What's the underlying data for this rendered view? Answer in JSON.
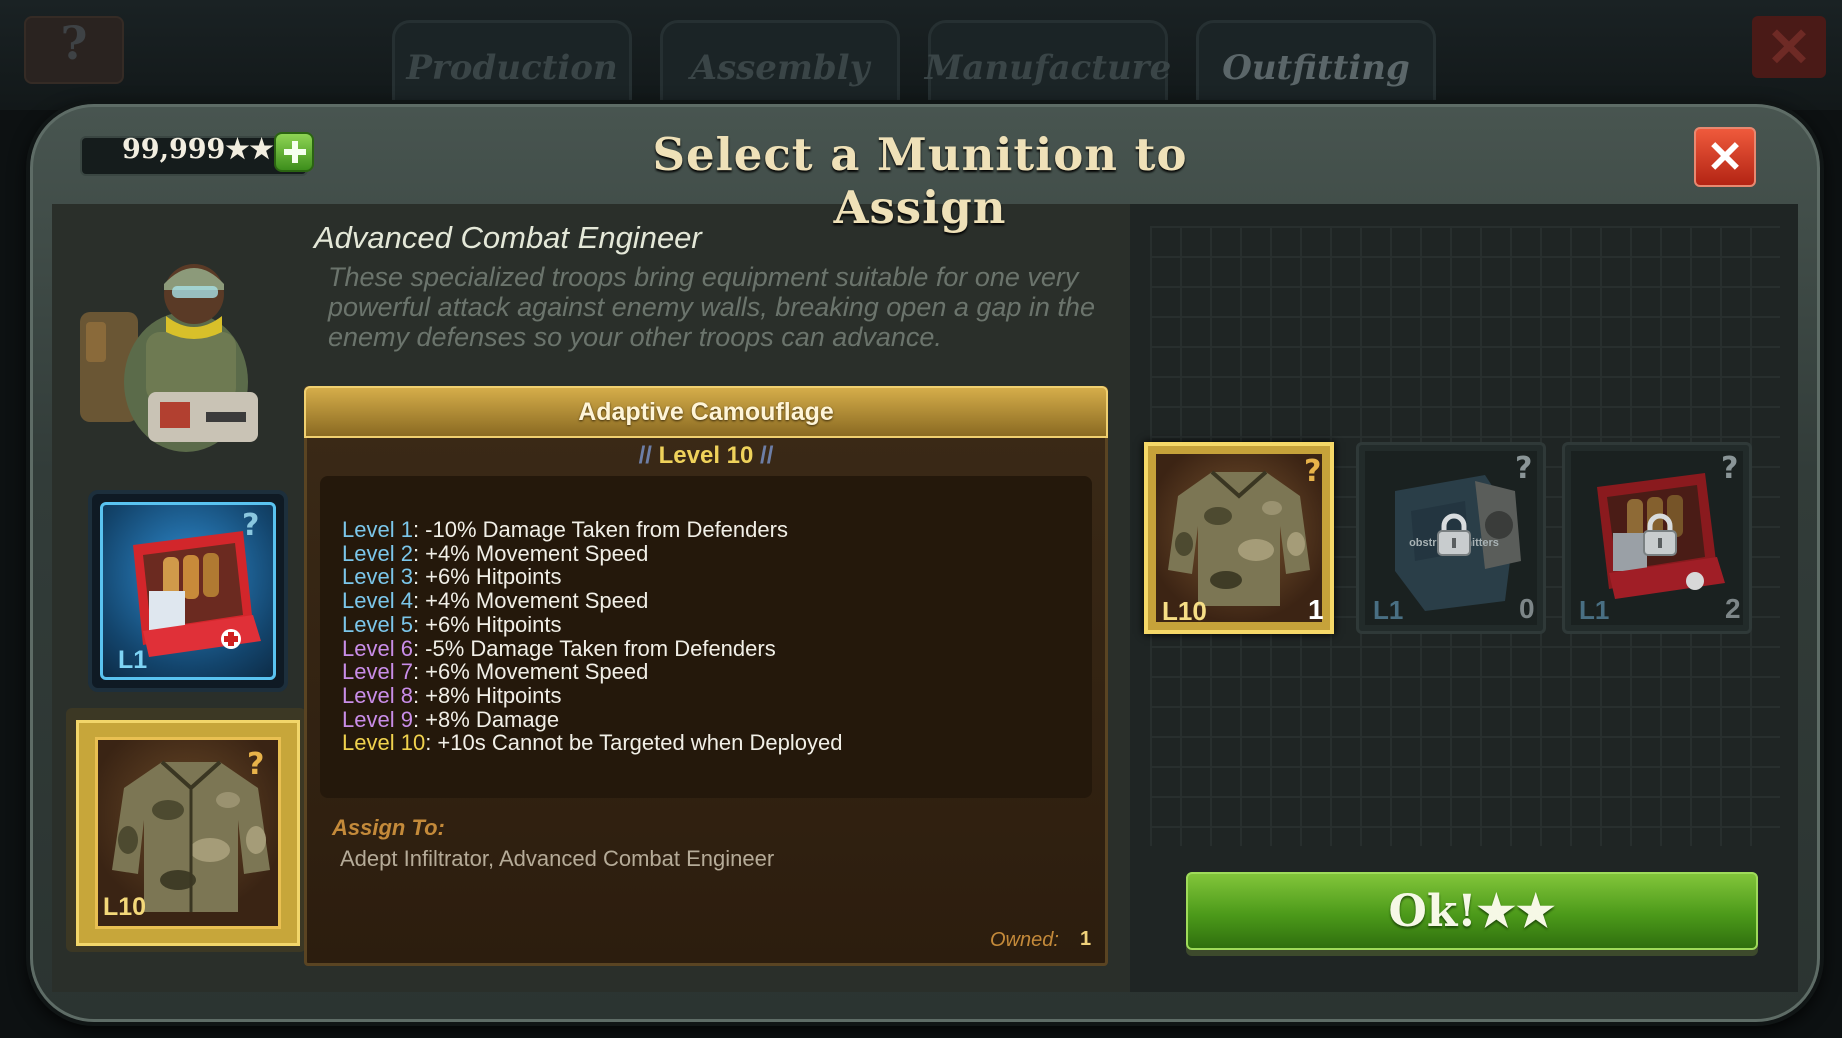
{
  "background_tabs": [
    "Production",
    "Assembly",
    "Manufacture",
    "Outfitting"
  ],
  "currency": "99,999★★",
  "title": "Select a Munition to Assign",
  "troop": {
    "name": "Advanced Combat Engineer",
    "description": "These specialized troops bring equipment suitable for one very powerful attack against enemy walls, breaking open a gap in the enemy defenses so your other troops can advance."
  },
  "left_slots": [
    {
      "level": "L1",
      "item": "medkit"
    },
    {
      "level": "L10",
      "item": "camo-jacket"
    }
  ],
  "munition": {
    "name": "Adaptive Camouflage",
    "level_label": "Level 10",
    "levels": [
      {
        "label": "Level 1",
        "text": ": -10% Damage Taken from Defenders",
        "color": "#7bc6ea"
      },
      {
        "label": "Level 2",
        "text": ": +4% Movement Speed",
        "color": "#7bc6ea"
      },
      {
        "label": "Level 3",
        "text": ": +6% Hitpoints",
        "color": "#7bc6ea"
      },
      {
        "label": "Level 4",
        "text": ": +4% Movement Speed",
        "color": "#7bc6ea"
      },
      {
        "label": "Level 5",
        "text": ": +6% Hitpoints",
        "color": "#7bc6ea"
      },
      {
        "label": "Level 6",
        "text": ": -5% Damage Taken from Defenders",
        "color": "#c98de8"
      },
      {
        "label": "Level 7",
        "text": ": +6% Movement Speed",
        "color": "#c98de8"
      },
      {
        "label": "Level 8",
        "text": ": +8% Hitpoints",
        "color": "#c98de8"
      },
      {
        "label": "Level 9",
        "text": ": +8% Damage",
        "color": "#c98de8"
      },
      {
        "label": "Level 10",
        "text": ": +10s Cannot be Targeted when Deployed",
        "color": "#f0d24e"
      }
    ],
    "assign_label": "Assign To:",
    "assign_to": "Adept Infiltrator, Advanced Combat Engineer",
    "owned_label": "Owned:",
    "owned": "1"
  },
  "cards": [
    {
      "level": "L10",
      "count": "1",
      "item": "camo-jacket",
      "locked": false
    },
    {
      "level": "L1",
      "count": "0",
      "item": "transmitter",
      "locked": true,
      "overlay_text": "obstruct  smitters"
    },
    {
      "level": "L1",
      "count": "2",
      "item": "medkit",
      "locked": true
    }
  ],
  "ok_label": "Ok!★★",
  "colors": {
    "gold": "#f0d24e",
    "blue_level": "#7bc6ea",
    "purple_level": "#c98de8",
    "ok_green": "#4c9a1a",
    "close_red": "#c93520"
  }
}
